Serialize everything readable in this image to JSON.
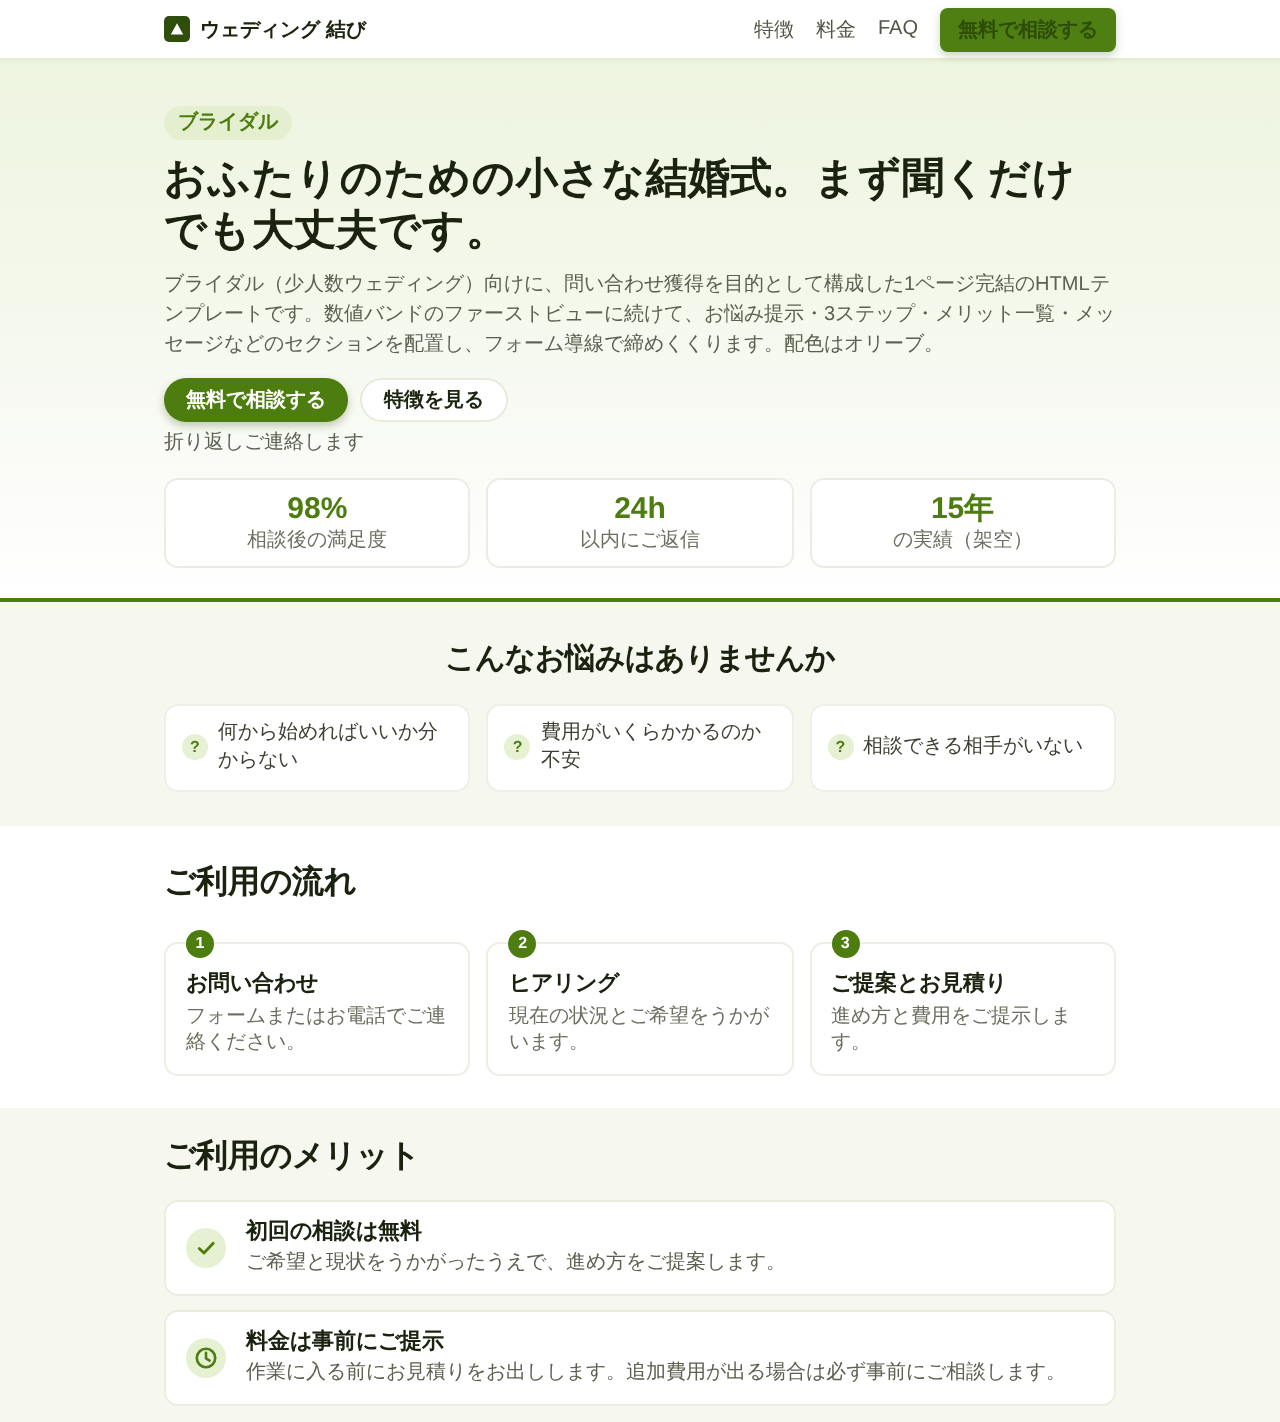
{
  "header": {
    "brand": "ウェディング 結び",
    "nav": [
      {
        "label": "特徴"
      },
      {
        "label": "料金"
      },
      {
        "label": "FAQ"
      }
    ],
    "cta": "無料で相談する"
  },
  "hero": {
    "badge": "ブライダル",
    "title": "おふたりのための小さな結婚式。まず聞くだけでも大丈夫です。",
    "lead": "ブライダル（少人数ウェディング）向けに、問い合わせ獲得を目的として構成した1ページ完結のHTMLテンプレートです。数値バンドのファーストビューに続けて、お悩み提示・3ステップ・メリット一覧・メッセージなどのセクションを配置し、フォーム導線で締めくくります。配色はオリーブ。",
    "buttons": [
      {
        "label": "無料で相談する",
        "kind": "primary"
      },
      {
        "label": "特徴を見る",
        "kind": "secondary"
      }
    ],
    "note": "折り返しご連絡します",
    "stats": [
      {
        "value": "98%",
        "label": "相談後の満足度"
      },
      {
        "value": "24h",
        "label": "以内にご返信"
      },
      {
        "value": "15年",
        "label": "の実績（架空）"
      }
    ]
  },
  "problems": {
    "title": "こんなお悩みはありませんか",
    "items": [
      {
        "mark": "?",
        "text": "何から始めればいいか分からない"
      },
      {
        "mark": "?",
        "text": "費用がいくらかかるのか不安"
      },
      {
        "mark": "?",
        "text": "相談できる相手がいない"
      }
    ]
  },
  "flow": {
    "title": "ご利用の流れ",
    "steps": [
      {
        "number": "1",
        "title": "お問い合わせ",
        "text": "フォームまたはお電話でご連絡ください。"
      },
      {
        "number": "2",
        "title": "ヒアリング",
        "text": "現在の状況とご希望をうかがいます。"
      },
      {
        "number": "3",
        "title": "ご提案とお見積り",
        "text": "進め方と費用をご提示します。"
      }
    ]
  },
  "merits": {
    "title": "ご利用のメリット",
    "items": [
      {
        "kind": "check",
        "title": "初回の相談は無料",
        "text": "ご希望と現状をうかがったうえで、進め方をご提案します。"
      },
      {
        "kind": "clock",
        "title": "料金は事前にご提示",
        "text": "作業に入る前にお見積りをお出しします。追加費用が出る場合は必ず事前にご相談します。"
      }
    ]
  }
}
